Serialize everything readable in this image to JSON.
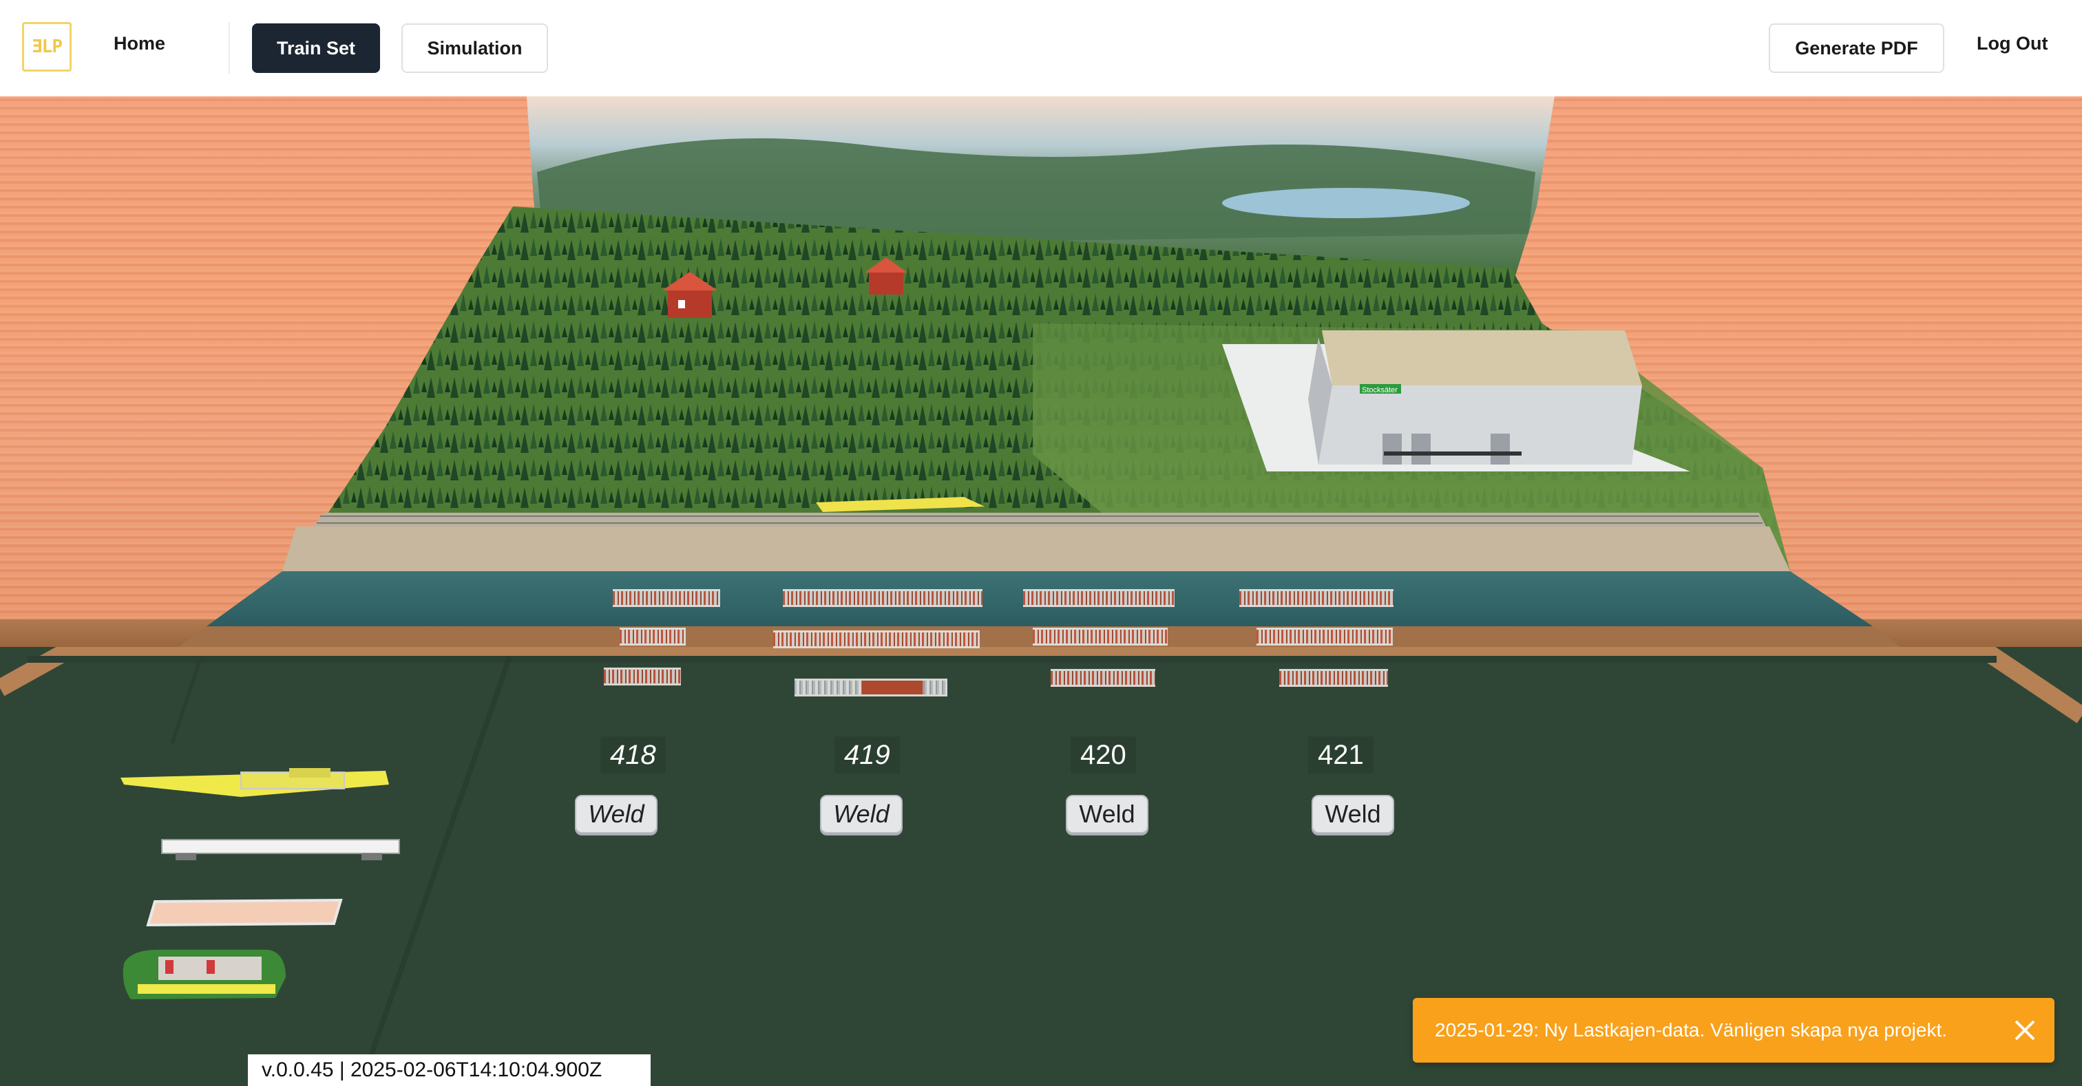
{
  "nav": {
    "logo_text": "ƎLP",
    "home": "Home",
    "train_set": "Train Set",
    "simulation": "Simulation",
    "generate_pdf": "Generate PDF",
    "log_out": "Log Out"
  },
  "scene": {
    "warehouse_sign": "Stocksäter",
    "stations": [
      {
        "number": "418",
        "action": "Weld"
      },
      {
        "number": "419",
        "action": "Weld"
      },
      {
        "number": "420",
        "action": "Weld"
      },
      {
        "number": "421",
        "action": "Weld"
      }
    ],
    "rolling_stock": [
      {
        "name": "yellow-track-machine-icon"
      },
      {
        "name": "white-flatcar-icon"
      },
      {
        "name": "peach-flatcar-icon"
      },
      {
        "name": "green-locomotive-icon"
      }
    ]
  },
  "version": "v.0.0.45 | 2025-02-06T14:10:04.900Z",
  "notification": {
    "message": "2025-01-29: Ny Lastkajen-data. Vänligen skapa nya projekt.",
    "close_icon": "close-icon",
    "color": "#f9a11b"
  },
  "colors": {
    "accent_dark": "#1c2633",
    "mat_green": "#2f4636",
    "table_wood": "#f3a07a"
  }
}
